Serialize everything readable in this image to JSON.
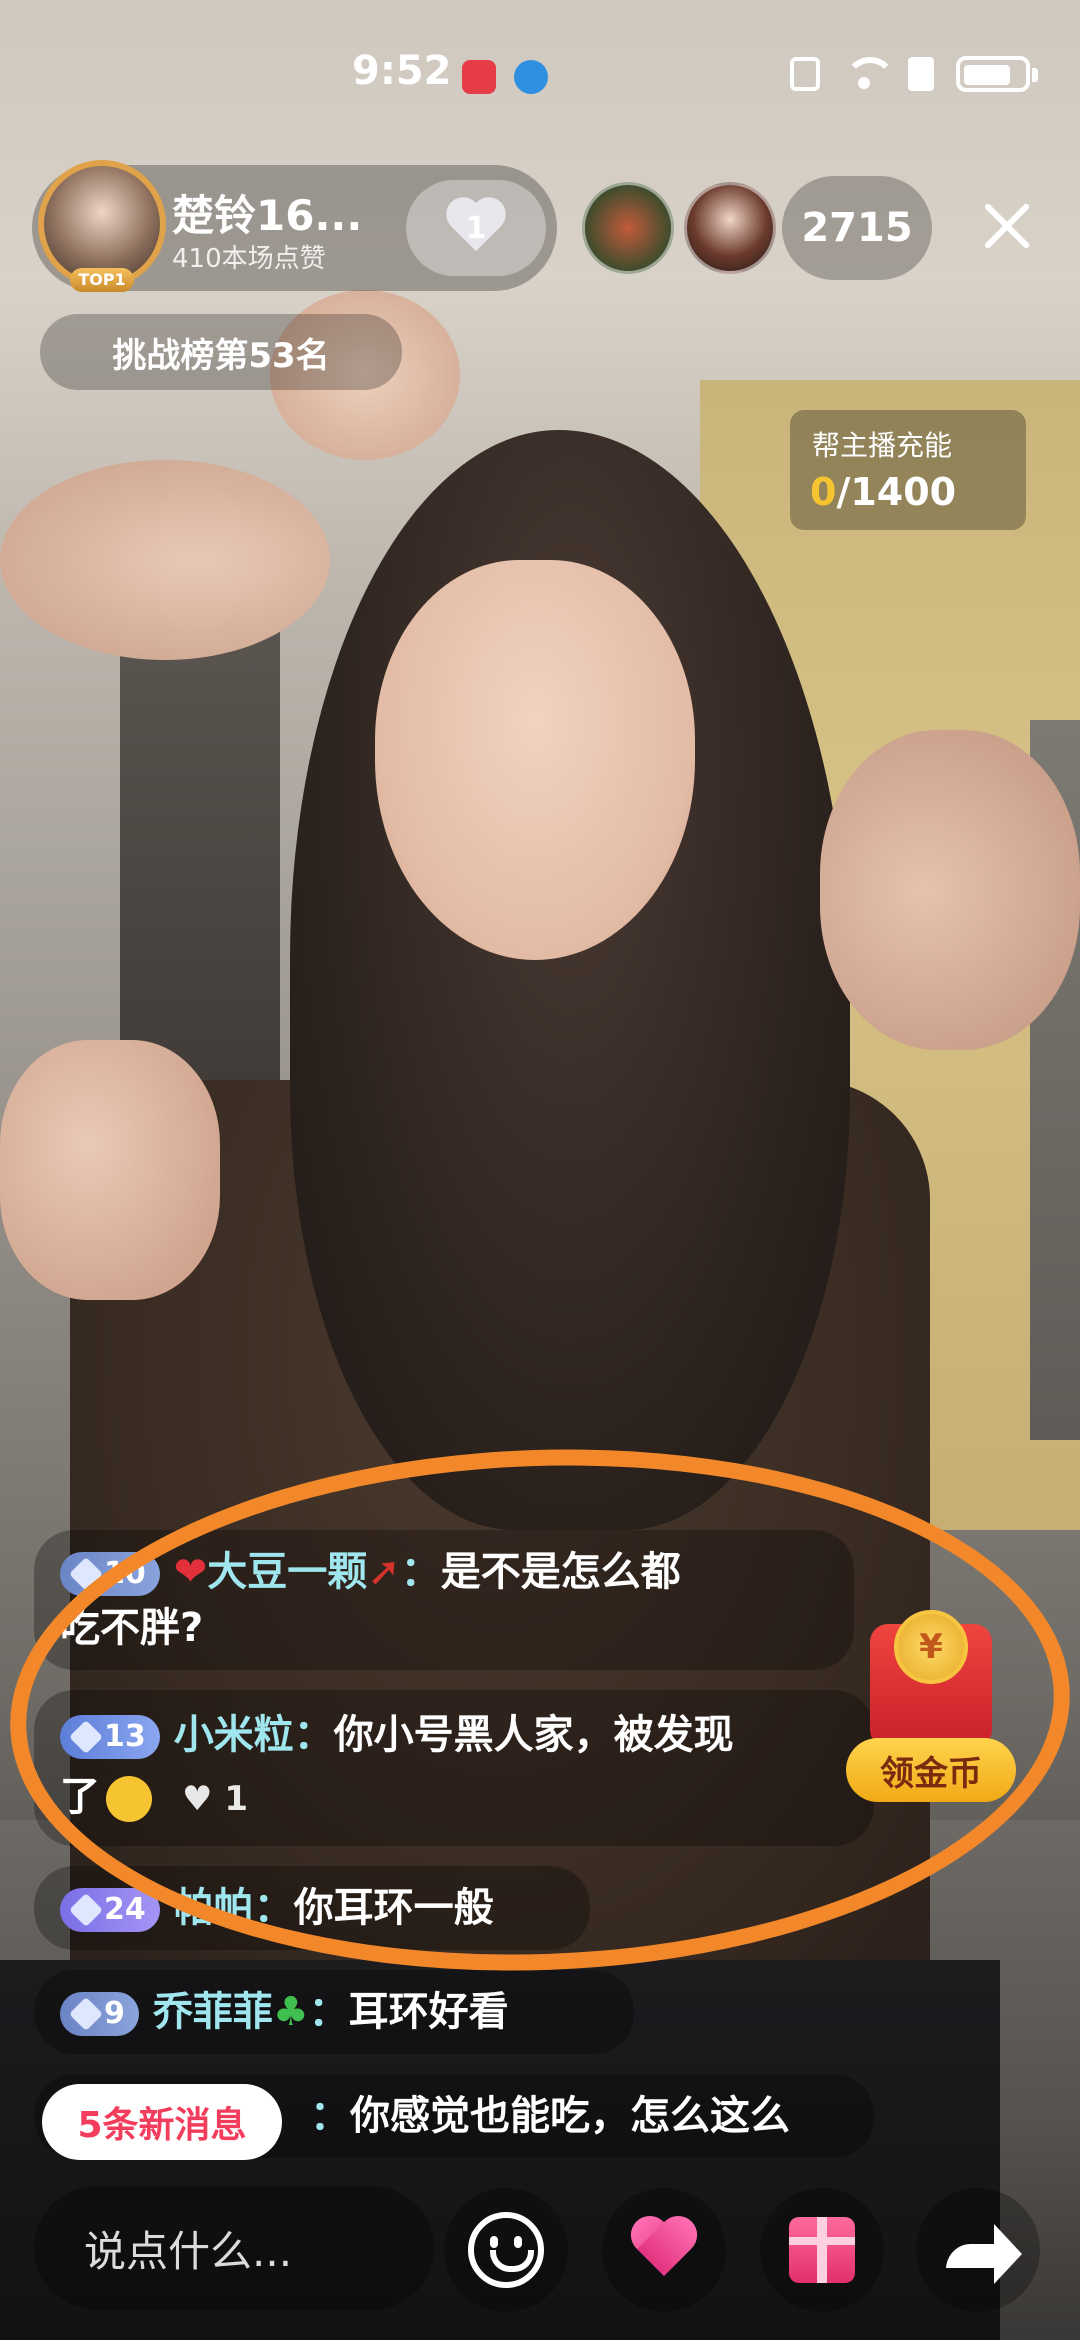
{
  "status_bar": {
    "time": "9:52",
    "icons": [
      "app-red-icon",
      "browser-icon",
      "nfc-icon",
      "wifi-icon",
      "sim-alert-icon",
      "battery-icon"
    ]
  },
  "host": {
    "name": "楚铃16...",
    "likes": "410本场点赞",
    "badge": "TOP1",
    "follow_count": "1"
  },
  "viewers": {
    "count": "2715"
  },
  "rank": {
    "label": "挑战榜第53名"
  },
  "charge": {
    "title": "帮主播充能",
    "current": "0",
    "separator": "/",
    "goal": "1400"
  },
  "comments": [
    {
      "level": "10",
      "prefix_icon": "heart-emoji",
      "user": "大豆一颗",
      "suffix_icon": "chili-emoji",
      "colon": "：",
      "text_line1": "是不是怎么都",
      "text_line2": "吃不胖?"
    },
    {
      "level": "13",
      "user": "小米粒",
      "colon": "：",
      "text_line1": "你小号黑人家，被发现",
      "text_line2": "了",
      "emoji": "laughing-emoji",
      "likes": "♥ 1"
    },
    {
      "level": "24",
      "user": "帕帕",
      "colon": "：",
      "text": "你耳环一般"
    },
    {
      "level": "9",
      "user": "乔菲菲",
      "suffix_icon": "clover-emoji",
      "colon": "：",
      "text": "耳环好看"
    },
    {
      "colon": "：",
      "text": "你感觉也能吃，怎么这么"
    }
  ],
  "new_messages": {
    "label": "5条新消息"
  },
  "coin_widget": {
    "coin_symbol": "¥",
    "label": "领金币"
  },
  "bottom_bar": {
    "input_placeholder": "说点什么..."
  },
  "colors": {
    "annotation": "#f2882a",
    "username": "#9fe6ef",
    "new_message_text": "#f23d5c",
    "charge_current": "#f7c431"
  }
}
